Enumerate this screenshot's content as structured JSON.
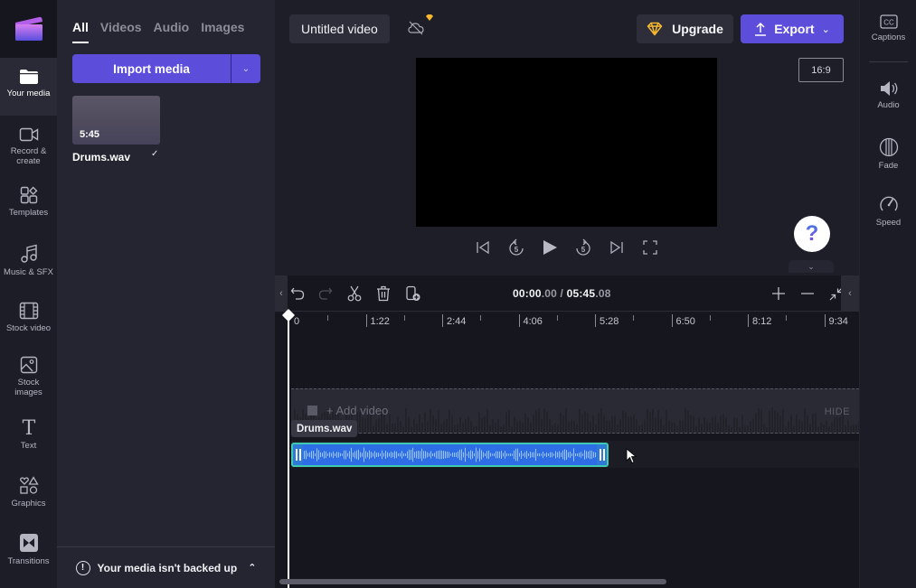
{
  "nav": {
    "logo": "clipchamp-logo",
    "items": [
      {
        "label": "Your media",
        "icon": "folder-icon",
        "active": true
      },
      {
        "label": "Record & create",
        "icon": "camera-icon"
      },
      {
        "label": "Templates",
        "icon": "templates-icon"
      },
      {
        "label": "Music & SFX",
        "icon": "music-icon"
      },
      {
        "label": "Stock video",
        "icon": "film-icon"
      },
      {
        "label": "Stock images",
        "icon": "image-icon"
      },
      {
        "label": "Text",
        "icon": "text-icon"
      },
      {
        "label": "Graphics",
        "icon": "shapes-icon"
      },
      {
        "label": "Transitions",
        "icon": "transition-icon"
      }
    ]
  },
  "media": {
    "tabs": [
      {
        "label": "All",
        "active": true
      },
      {
        "label": "Videos"
      },
      {
        "label": "Audio"
      },
      {
        "label": "Images"
      }
    ],
    "import_label": "Import media",
    "items": [
      {
        "name": "Drums.wav",
        "duration": "5:45",
        "added": true
      }
    ],
    "backup_notice": "Your media isn't backed up"
  },
  "header": {
    "project_title": "Untitled video",
    "upgrade_label": "Upgrade",
    "export_label": "Export",
    "aspect_ratio": "16:9"
  },
  "colors": {
    "accent": "#5c4ddb",
    "clip": "#2d6ee6",
    "clip_border": "#3ec9b0",
    "gem": "#f5b82e"
  },
  "timeline": {
    "current_time": "00:00",
    "current_frac": ".00",
    "separator": " / ",
    "total_time": "05:45",
    "total_frac": ".08",
    "ruler_labels": [
      "0",
      "1:22",
      "2:44",
      "4:06",
      "5:28",
      "6:50",
      "8:12",
      "9:34"
    ],
    "add_video_label": "+ Add video",
    "hide_label": "HIDE",
    "clip_name": "Drums.wav"
  },
  "props": {
    "items": [
      {
        "label": "Captions",
        "icon": "captions-icon"
      },
      {
        "label": "Audio",
        "icon": "speaker-icon"
      },
      {
        "label": "Fade",
        "icon": "fade-icon"
      },
      {
        "label": "Speed",
        "icon": "speedometer-icon"
      }
    ]
  },
  "help_label": "?"
}
